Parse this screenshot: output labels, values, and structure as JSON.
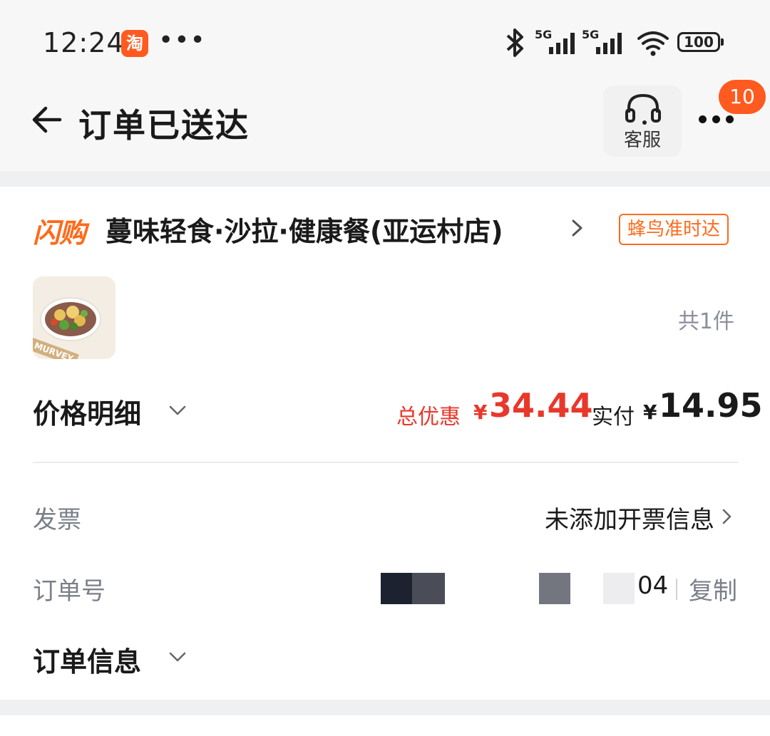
{
  "status_bar": {
    "time": "12:24",
    "app_icon_text": "淘",
    "more": "•••",
    "signal_1_label": "5G",
    "signal_2_label": "5G",
    "battery": "100",
    "icons": [
      "bluetooth-icon",
      "signal-icon",
      "signal-icon",
      "wifi-icon",
      "battery-icon"
    ]
  },
  "header": {
    "title": "订单已送达",
    "service_label": "客服",
    "badge_count": "10"
  },
  "shop": {
    "channel_logo": "闪购",
    "name": "蔓味轻食·沙拉·健康餐(亚运村店)",
    "delivery_tag": "蜂鸟准时达"
  },
  "product": {
    "thumb_brand": "MURVEY",
    "count_label": "共1件"
  },
  "price": {
    "detail_label": "价格明细",
    "discount_label": "总优惠",
    "currency": "¥",
    "discount_value": "34.44",
    "paid_label": "实付",
    "paid_value": "14.95"
  },
  "invoice": {
    "label": "发票",
    "value": "未添加开票信息"
  },
  "order_number": {
    "label": "订单号",
    "visible_suffix": "04",
    "copy_label": "复制"
  },
  "order_info": {
    "label": "订单信息"
  },
  "colors": {
    "accent_orange": "#ff6a1a",
    "discount_red": "#e8382c",
    "badge_orange": "#ff5a1f",
    "muted_text": "#7a7f88"
  }
}
